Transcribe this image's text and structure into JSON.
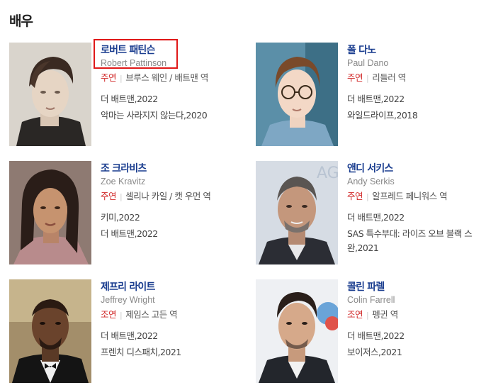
{
  "section": {
    "title": "배우"
  },
  "actors": [
    {
      "name_ko": "로버트 패틴슨",
      "name_en": "Robert Pattinson",
      "role_type": "주연",
      "role": "브루스 웨인 / 배트맨 역",
      "works": [
        "더 배트맨,2022",
        "악마는 사라지지 않는다,2020"
      ]
    },
    {
      "name_ko": "폴 다노",
      "name_en": "Paul Dano",
      "role_type": "주연",
      "role": "리들러 역",
      "works": [
        "더 배트맨,2022",
        "와일드라이프,2018"
      ]
    },
    {
      "name_ko": "조 크라비츠",
      "name_en": "Zoe Kravitz",
      "role_type": "주연",
      "role": "셀리나 카일 / 캣 우먼 역",
      "works": [
        "키미,2022",
        "더 배트맨,2022"
      ]
    },
    {
      "name_ko": "앤디 서키스",
      "name_en": "Andy Serkis",
      "role_type": "주연",
      "role": "알프레드 페니워스 역",
      "works": [
        "더 배트맨,2022",
        "SAS 특수부대: 라이즈 오브 블랙 스완,2021"
      ]
    },
    {
      "name_ko": "제프리 라이트",
      "name_en": "Jeffrey Wright",
      "role_type": "조연",
      "role": "제임스 고든 역",
      "works": [
        "더 배트맨,2022",
        "프렌치 디스패치,2021"
      ]
    },
    {
      "name_ko": "콜린 파렐",
      "name_en": "Colin Farrell",
      "role_type": "조연",
      "role": "펭귄 역",
      "works": [
        "더 배트맨,2022",
        "보이저스,2021"
      ]
    }
  ],
  "colors": {
    "name_link": "#1a3d8f",
    "role_type": "#d22a2a",
    "highlight": "#e01818"
  }
}
